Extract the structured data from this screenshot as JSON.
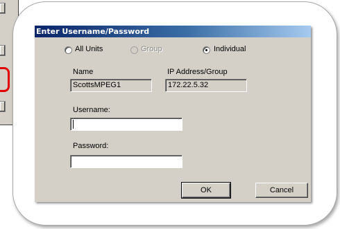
{
  "dialog": {
    "title": "Enter Username/Password",
    "scope_options": [
      {
        "label": "All Units",
        "selected": false,
        "enabled": true
      },
      {
        "label": "Group",
        "selected": false,
        "enabled": false
      },
      {
        "label": "Individual",
        "selected": true,
        "enabled": true
      }
    ],
    "name_label": "Name",
    "name_value": "ScottsMPEG1",
    "ip_label": "IP Address/Group",
    "ip_value": "172.22.5.32",
    "username_label": "Username:",
    "username_value": "",
    "password_label": "Password:",
    "password_value": "",
    "ok_label": "OK",
    "cancel_label": "Cancel"
  },
  "colors": {
    "titlebar_start": "#0a246a",
    "titlebar_end": "#a6caf0",
    "dialog_face": "#d4d0c8",
    "highlight_mark": "#e00000"
  }
}
